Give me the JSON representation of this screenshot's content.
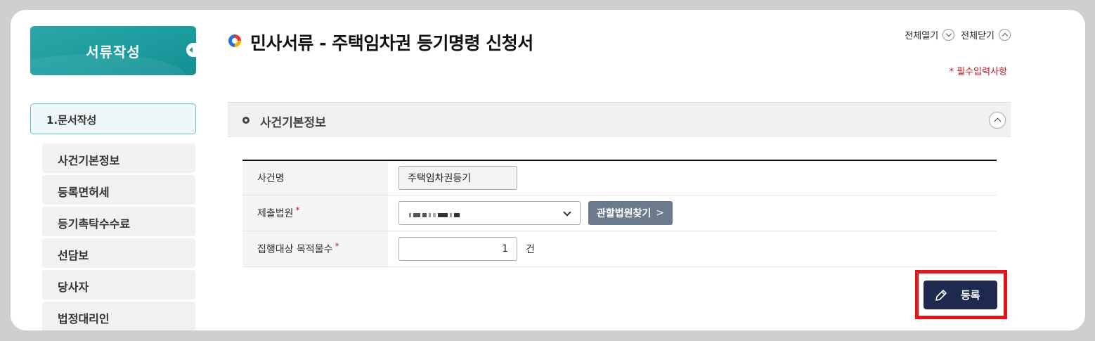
{
  "sidebar": {
    "header": "서류작성",
    "step": "1.문서작성",
    "items": [
      {
        "label": "사건기본정보"
      },
      {
        "label": "등록면허세"
      },
      {
        "label": "등기촉탁수수료"
      },
      {
        "label": "선담보"
      },
      {
        "label": "당사자"
      },
      {
        "label": "법정대리인"
      }
    ]
  },
  "header": {
    "title": "민사서류 - 주택임차권 등기명령 신청서",
    "expand_all": "전체열기",
    "collapse_all": "전체닫기",
    "required_note": "* 필수입력사항"
  },
  "section": {
    "title": "사건기본정보",
    "fields": {
      "case_name": {
        "label": "사건명",
        "value": "주택임차권등기"
      },
      "court": {
        "label": "제출법원",
        "required_mark": "*",
        "find_button": "관할법원찾기",
        "chevron": ">"
      },
      "targets": {
        "label": "집행대상 목적물수",
        "required_mark": "*",
        "value": "1",
        "unit": "건"
      }
    }
  },
  "actions": {
    "register": "등록"
  },
  "colors": {
    "accent_teal": "#1c9c9e",
    "navy_button": "#1e2a4f",
    "required_red": "#c4161c",
    "highlight_red": "#e3141c"
  }
}
